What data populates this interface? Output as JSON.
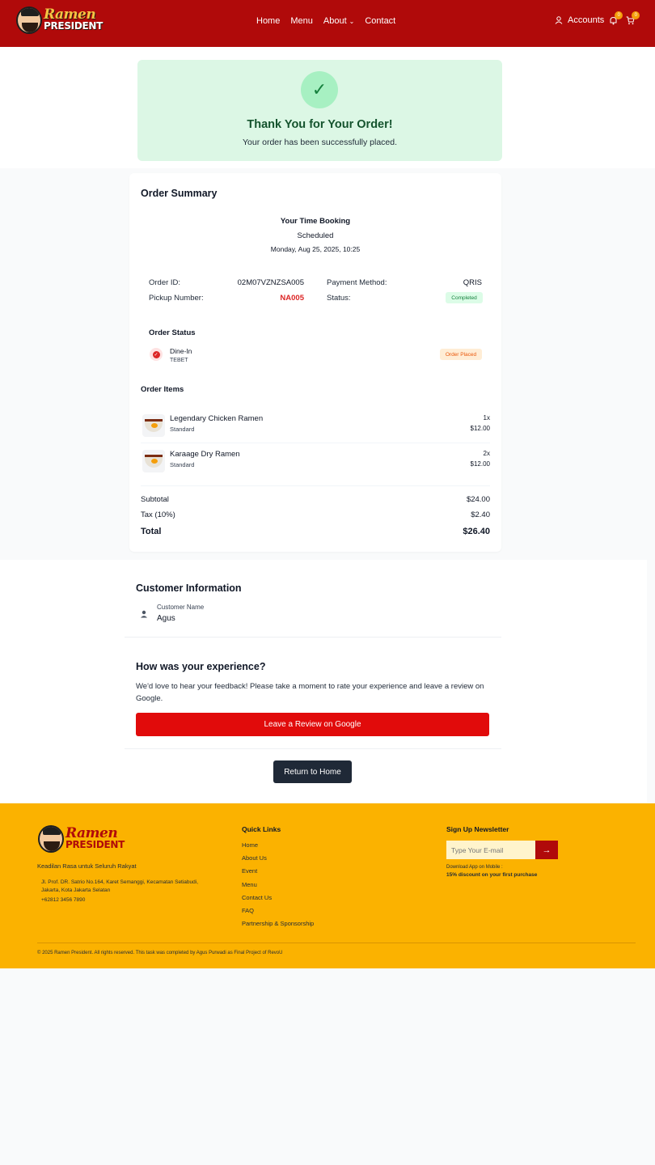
{
  "header": {
    "brand_line1": "Ramen",
    "brand_line2": "PRESIDENT",
    "nav": [
      "Home",
      "Menu",
      "About",
      "Contact"
    ],
    "accounts_label": "Accounts",
    "notif_count": "0",
    "cart_count": "0"
  },
  "success": {
    "title": "Thank You for Your Order!",
    "subtitle": "Your order has been successfully placed."
  },
  "summary": {
    "title": "Order Summary",
    "booking_title": "Your Time Booking",
    "booking_status": "Scheduled",
    "booking_date": "Monday, Aug 25, 2025, 10:25",
    "order_id_label": "Order ID:",
    "order_id": "02M07VZNZSA005",
    "pickup_label": "Pickup Number:",
    "pickup": "NA005",
    "payment_label": "Payment Method:",
    "payment": "QRIS",
    "status_label": "Status:",
    "status": "Completed",
    "order_status_title": "Order Status",
    "dine_type": "Dine-In",
    "location": "TEBET",
    "order_status_badge": "Order Placed",
    "items_title": "Order Items",
    "items": [
      {
        "name": "Legendary Chicken Ramen",
        "variant": "Standard",
        "qty": "1x",
        "price": "$12.00"
      },
      {
        "name": "Karaage Dry Ramen",
        "variant": "Standard",
        "qty": "2x",
        "price": "$12.00"
      }
    ],
    "subtotal_label": "Subtotal",
    "subtotal": "$24.00",
    "tax_label": "Tax (10%)",
    "tax": "$2.40",
    "total_label": "Total",
    "total": "$26.40"
  },
  "customer": {
    "title": "Customer Information",
    "name_label": "Customer Name",
    "name": "Agus"
  },
  "experience": {
    "title": "How was your experience?",
    "text": "We'd love to hear your feedback! Please take a moment to rate your experience and leave a review on Google.",
    "review_button": "Leave a Review on Google",
    "home_button": "Return to Home"
  },
  "footer": {
    "brand_line1": "Ramen",
    "brand_line2": "PRESIDENT",
    "tagline": "Keadilan Rasa untuk Seluruh Rakyat",
    "address": "Jl. Prof. DR. Satrio No.164, Karet Semanggi, Kecamatan Setiabudi, Jakarta, Kota Jakarta Selatan",
    "phone": "+62812 3456 7890",
    "quick_links_title": "Quick Links",
    "quick_links": [
      "Home",
      "About Us",
      "Event",
      "Menu",
      "Contact Us",
      "FAQ",
      "Partnership & Sponsorship"
    ],
    "newsletter_title": "Sign Up Newsletter",
    "email_placeholder": "Type Your E-mail",
    "app_note": "Download App on Mobile :",
    "discount_note": "15% discount on your first purchase",
    "copyright": "© 2025 Ramen President. All rights reserved. This task was completed by Agus Purwadi as Final Project of RevoU"
  },
  "colors": {
    "brand_red": "#b00a0a",
    "button_red": "#e10b0b",
    "success_bg": "#dcf7e5",
    "footer_yellow": "#fbb200",
    "dark_button": "#1f2937"
  }
}
